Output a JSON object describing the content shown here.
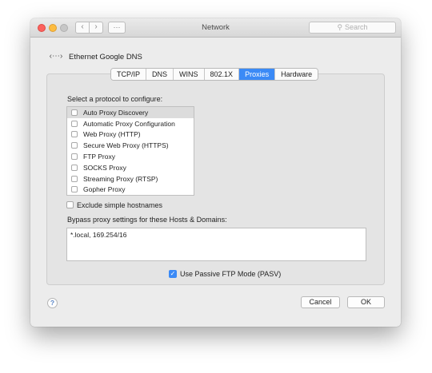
{
  "window": {
    "title": "Network",
    "search_placeholder": "Search"
  },
  "header": {
    "connection_name": "Ethernet Google DNS",
    "icon": "ethernet-icon"
  },
  "tabs": [
    {
      "label": "TCP/IP",
      "active": false
    },
    {
      "label": "DNS",
      "active": false
    },
    {
      "label": "WINS",
      "active": false
    },
    {
      "label": "802.1X",
      "active": false
    },
    {
      "label": "Proxies",
      "active": true
    },
    {
      "label": "Hardware",
      "active": false
    }
  ],
  "protocols": {
    "heading": "Select a protocol to configure:",
    "items": [
      {
        "label": "Auto Proxy Discovery",
        "checked": false,
        "selected": true
      },
      {
        "label": "Automatic Proxy Configuration",
        "checked": false
      },
      {
        "label": "Web Proxy (HTTP)",
        "checked": false
      },
      {
        "label": "Secure Web Proxy (HTTPS)",
        "checked": false
      },
      {
        "label": "FTP Proxy",
        "checked": false
      },
      {
        "label": "SOCKS Proxy",
        "checked": false
      },
      {
        "label": "Streaming Proxy (RTSP)",
        "checked": false
      },
      {
        "label": "Gopher Proxy",
        "checked": false
      }
    ]
  },
  "exclude_simple_hostnames": {
    "label": "Exclude simple hostnames",
    "checked": false
  },
  "bypass": {
    "label": "Bypass proxy settings for these Hosts & Domains:",
    "value": "*.local, 169.254/16"
  },
  "passive_ftp": {
    "label": "Use Passive FTP Mode (PASV)",
    "checked": true
  },
  "buttons": {
    "help": "?",
    "cancel": "Cancel",
    "ok": "OK"
  },
  "colors": {
    "accent": "#3b8af6",
    "close": "#fc615d",
    "minimize": "#fdbc40"
  }
}
